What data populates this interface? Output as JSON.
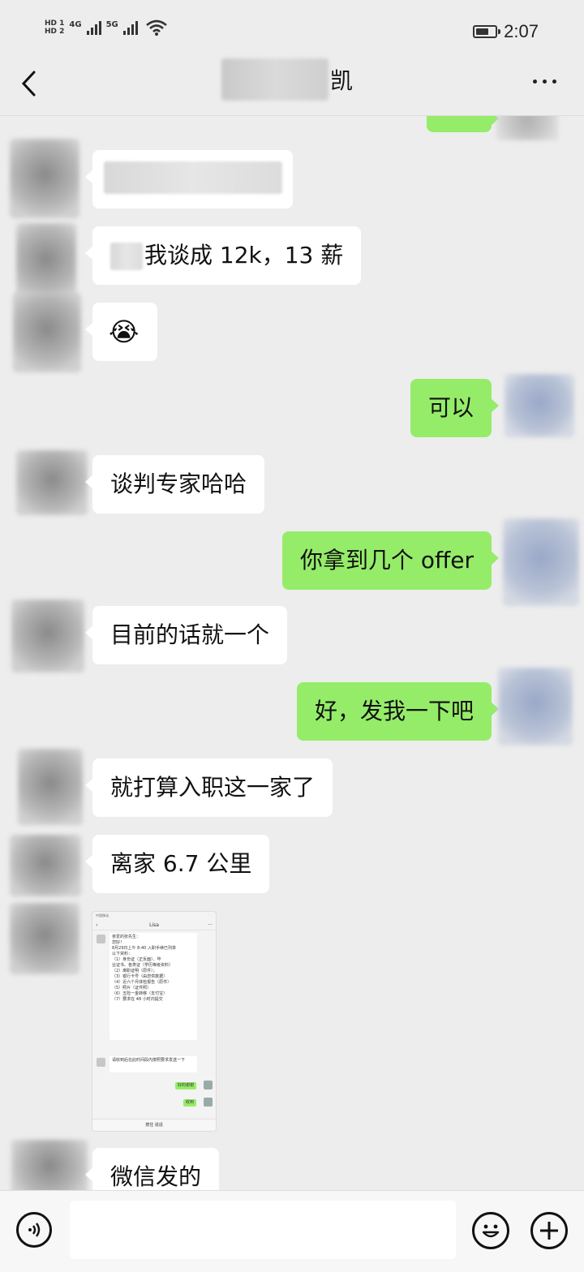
{
  "status_bar": {
    "sim1_label": "HD 1",
    "sim2_label": "HD 2",
    "net1": "4G",
    "net2": "5G",
    "time": "2:07",
    "battery_level": 0.7
  },
  "header": {
    "title_visible_suffix": "凯",
    "back_icon": "chevron-left-icon",
    "more_icon": "more-dots-icon"
  },
  "messages": [
    {
      "side": "left",
      "type": "text",
      "text": "谈我谈成 12k，13 薪",
      "visible_text": "我谈成 12k，13 薪"
    },
    {
      "side": "left",
      "type": "emoji",
      "emoji": "😭"
    },
    {
      "side": "right",
      "type": "text",
      "text": "可以"
    },
    {
      "side": "left",
      "type": "text",
      "text": "谈判专家哈哈"
    },
    {
      "side": "right",
      "type": "text",
      "text": "你拿到几个 offer"
    },
    {
      "side": "left",
      "type": "text",
      "text": "目前的话就一个"
    },
    {
      "side": "right",
      "type": "text",
      "text": "好，发我一下吧"
    },
    {
      "side": "left",
      "type": "text",
      "text": "就打算入职这一家了"
    },
    {
      "side": "left",
      "type": "text",
      "text": "离家 6.7 公里"
    },
    {
      "side": "left",
      "type": "image",
      "text": "screenshot"
    },
    {
      "side": "left",
      "type": "text",
      "text": "微信发的"
    }
  ],
  "shared_screenshot": {
    "title": "Lisa",
    "status": "中国移动",
    "lines": [
      "亲爱的张先生：",
      "您好！",
      "8月29日上午 8:40 入职手续已列单",
      "以下资料：",
      "（1）身份证（正反面）、毕",
      "业证书、各类证（学历等级资料）",
      "（2）离职证明（原件）；",
      "（3）银行卡号（由您供数据）",
      "（4）近六个月体检报告（原件）",
      "（5）照片（证件照）",
      "（6）五险一金转移（支付宝）",
      "（7）要求在 48 小时内提交"
    ],
    "reply_left": "请收到后在此时间段内按照要求发送一下",
    "reply_green_1": "好的谢谢",
    "reply_green_2": "收到",
    "bottom_bar": "按住 说话"
  },
  "input_bar": {
    "voice_icon": "voice-icon",
    "emoji_icon": "emoji-icon",
    "plus_icon": "plus-icon",
    "placeholder": ""
  }
}
